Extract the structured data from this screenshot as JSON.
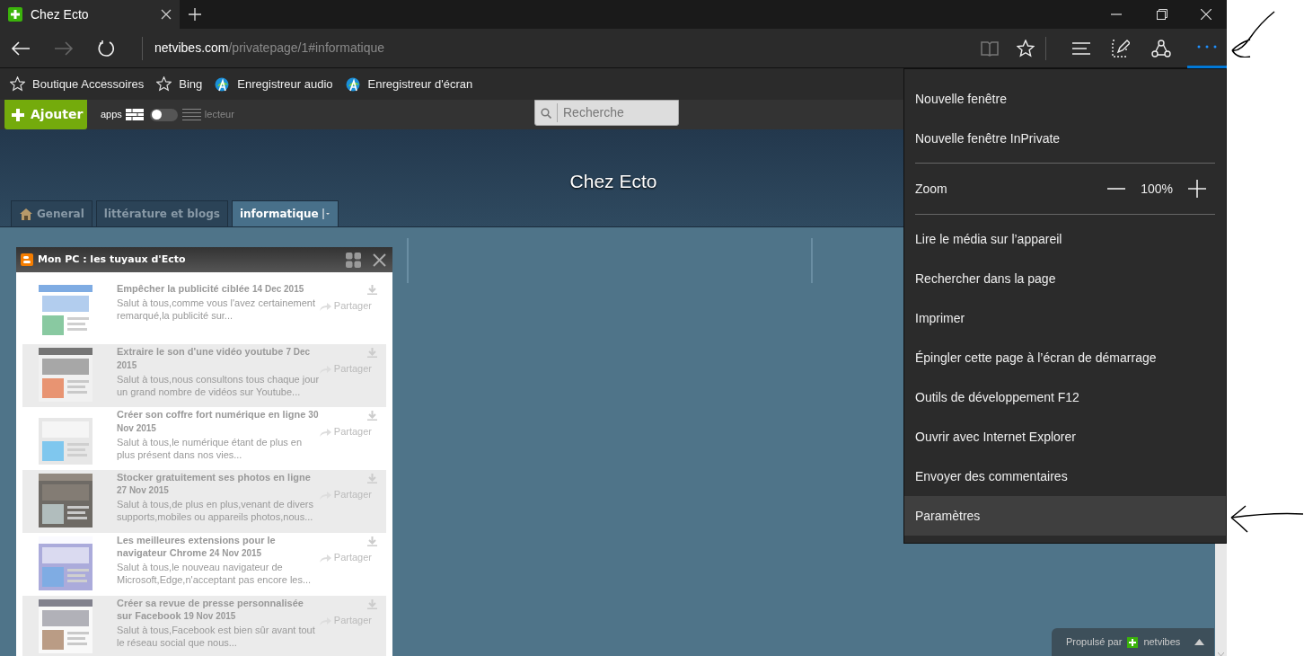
{
  "browser": {
    "tab_title": "Chez Ecto",
    "url_host": "netvibes.com",
    "url_path": "/privatepage/1#informatique",
    "menu_open": true
  },
  "favorites": [
    {
      "label": "Boutique Accessoires",
      "kind": "star"
    },
    {
      "label": "Bing",
      "kind": "star"
    },
    {
      "label": "Enregistreur audio",
      "kind": "app"
    },
    {
      "label": "Enregistreur d'écran",
      "kind": "app"
    }
  ],
  "toolbar": {
    "add_button": "Ajouter",
    "view_left": "apps",
    "view_right": "lecteur",
    "reader_on": false,
    "search_placeholder": "Recherche"
  },
  "page_title": "Chez Ecto",
  "tabs": [
    {
      "label": "General",
      "kind": "home",
      "selected": false
    },
    {
      "label": "littérature et blogs",
      "kind": "plain",
      "selected": false
    },
    {
      "label": "informatique",
      "kind": "plain",
      "selected": true
    }
  ],
  "widget": {
    "title": "Mon PC : les tuyaux d'Ecto",
    "articles": [
      {
        "title": "Empêcher la publicité ciblée",
        "date": "14 Dec 2015",
        "excerpt": "Salut à tous,comme vous l'avez certainement remarqué,la publicité sur...",
        "share": "Partager"
      },
      {
        "title": "Extraire le son d'une vidéo youtube",
        "date": "7 Dec 2015",
        "excerpt": "Salut à tous,nous consultons tous chaque jour un grand nombre de vidéos sur Youtube...",
        "share": "Partager"
      },
      {
        "title": "Créer son coffre fort numérique en ligne",
        "date": "30 Nov 2015",
        "excerpt": "Salut à tous,le numérique étant de plus en plus présent dans nos vies...",
        "share": "Partager"
      },
      {
        "title": "Stocker gratuitement ses photos en ligne",
        "date": "27 Nov 2015",
        "excerpt": "Salut à tous,de plus en plus,venant de divers supports,mobiles ou appareils photos,nous...",
        "share": "Partager"
      },
      {
        "title": "Les meilleures extensions pour le navigateur Chrome",
        "date": "24 Nov 2015",
        "excerpt": "Salut à tous,le nouveau navigateur de Microsoft,Edge,n'acceptant pas encore les...",
        "share": "Partager"
      },
      {
        "title": "Créer sa revue de presse personnalisée sur Facebook",
        "date": "19 Nov 2015",
        "excerpt": "Salut à tous,Facebook est bien sûr avant tout le réseau social que nous...",
        "share": "Partager"
      }
    ]
  },
  "menu": [
    {
      "kind": "item",
      "label": "Nouvelle fenêtre",
      "selected": false
    },
    {
      "kind": "item",
      "label": "Nouvelle fenêtre InPrivate",
      "selected": false
    },
    {
      "kind": "separator"
    },
    {
      "kind": "zoom",
      "label": "Zoom",
      "value": "100%"
    },
    {
      "kind": "separator"
    },
    {
      "kind": "item",
      "label": "Lire le média sur l’appareil",
      "selected": false
    },
    {
      "kind": "item",
      "label": "Rechercher dans la page",
      "selected": false
    },
    {
      "kind": "item",
      "label": "Imprimer",
      "selected": false
    },
    {
      "kind": "item",
      "label": "Épingler cette page à l’écran de démarrage",
      "selected": false
    },
    {
      "kind": "item",
      "label": "Outils de développement F12",
      "selected": false
    },
    {
      "kind": "item",
      "label": "Ouvrir avec Internet Explorer",
      "selected": false
    },
    {
      "kind": "item",
      "label": "Envoyer des commentaires",
      "selected": false
    },
    {
      "kind": "item",
      "label": "Paramètres",
      "selected": true
    }
  ],
  "footer": {
    "label": "Propulsé par",
    "brand": "netvibes"
  }
}
